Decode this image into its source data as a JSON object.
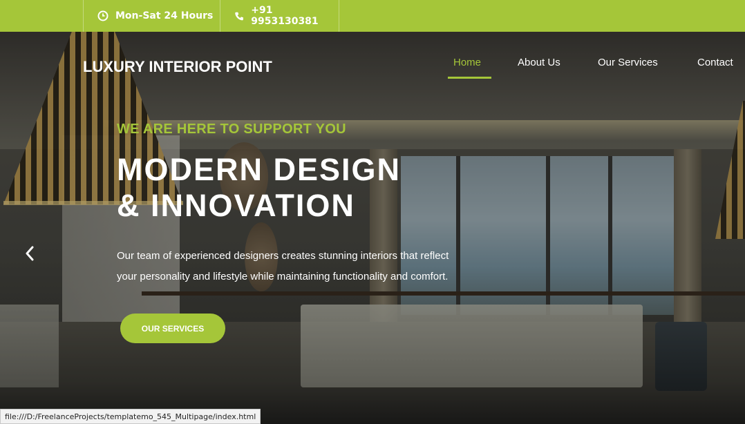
{
  "topbar": {
    "hours_icon": "clock-icon",
    "hours": "Mon-Sat 24 Hours",
    "phone_icon": "phone-icon",
    "phone": "+91 9953130381"
  },
  "header": {
    "brand": "LUXURY INTERIOR POINT",
    "nav": [
      {
        "label": "Home",
        "active": true
      },
      {
        "label": "About Us",
        "active": false
      },
      {
        "label": "Our Services",
        "active": false
      },
      {
        "label": "Contact",
        "active": false
      }
    ]
  },
  "hero": {
    "kicker": "WE ARE HERE TO SUPPORT YOU",
    "headline_line1": "MODERN DESIGN",
    "headline_line2": "& INNOVATION",
    "desc_line1": "Our team of experienced designers creates stunning interiors that reflect",
    "desc_line2": "your personality and lifestyle while maintaining functionality and comfort.",
    "cta": "OUR SERVICES",
    "prev_icon": "chevron-left-icon"
  },
  "status_url": "file:///D:/FreelanceProjects/templatemo_545_Multipage/index.html",
  "colors": {
    "accent": "#a5c639",
    "text": "#ffffff"
  }
}
